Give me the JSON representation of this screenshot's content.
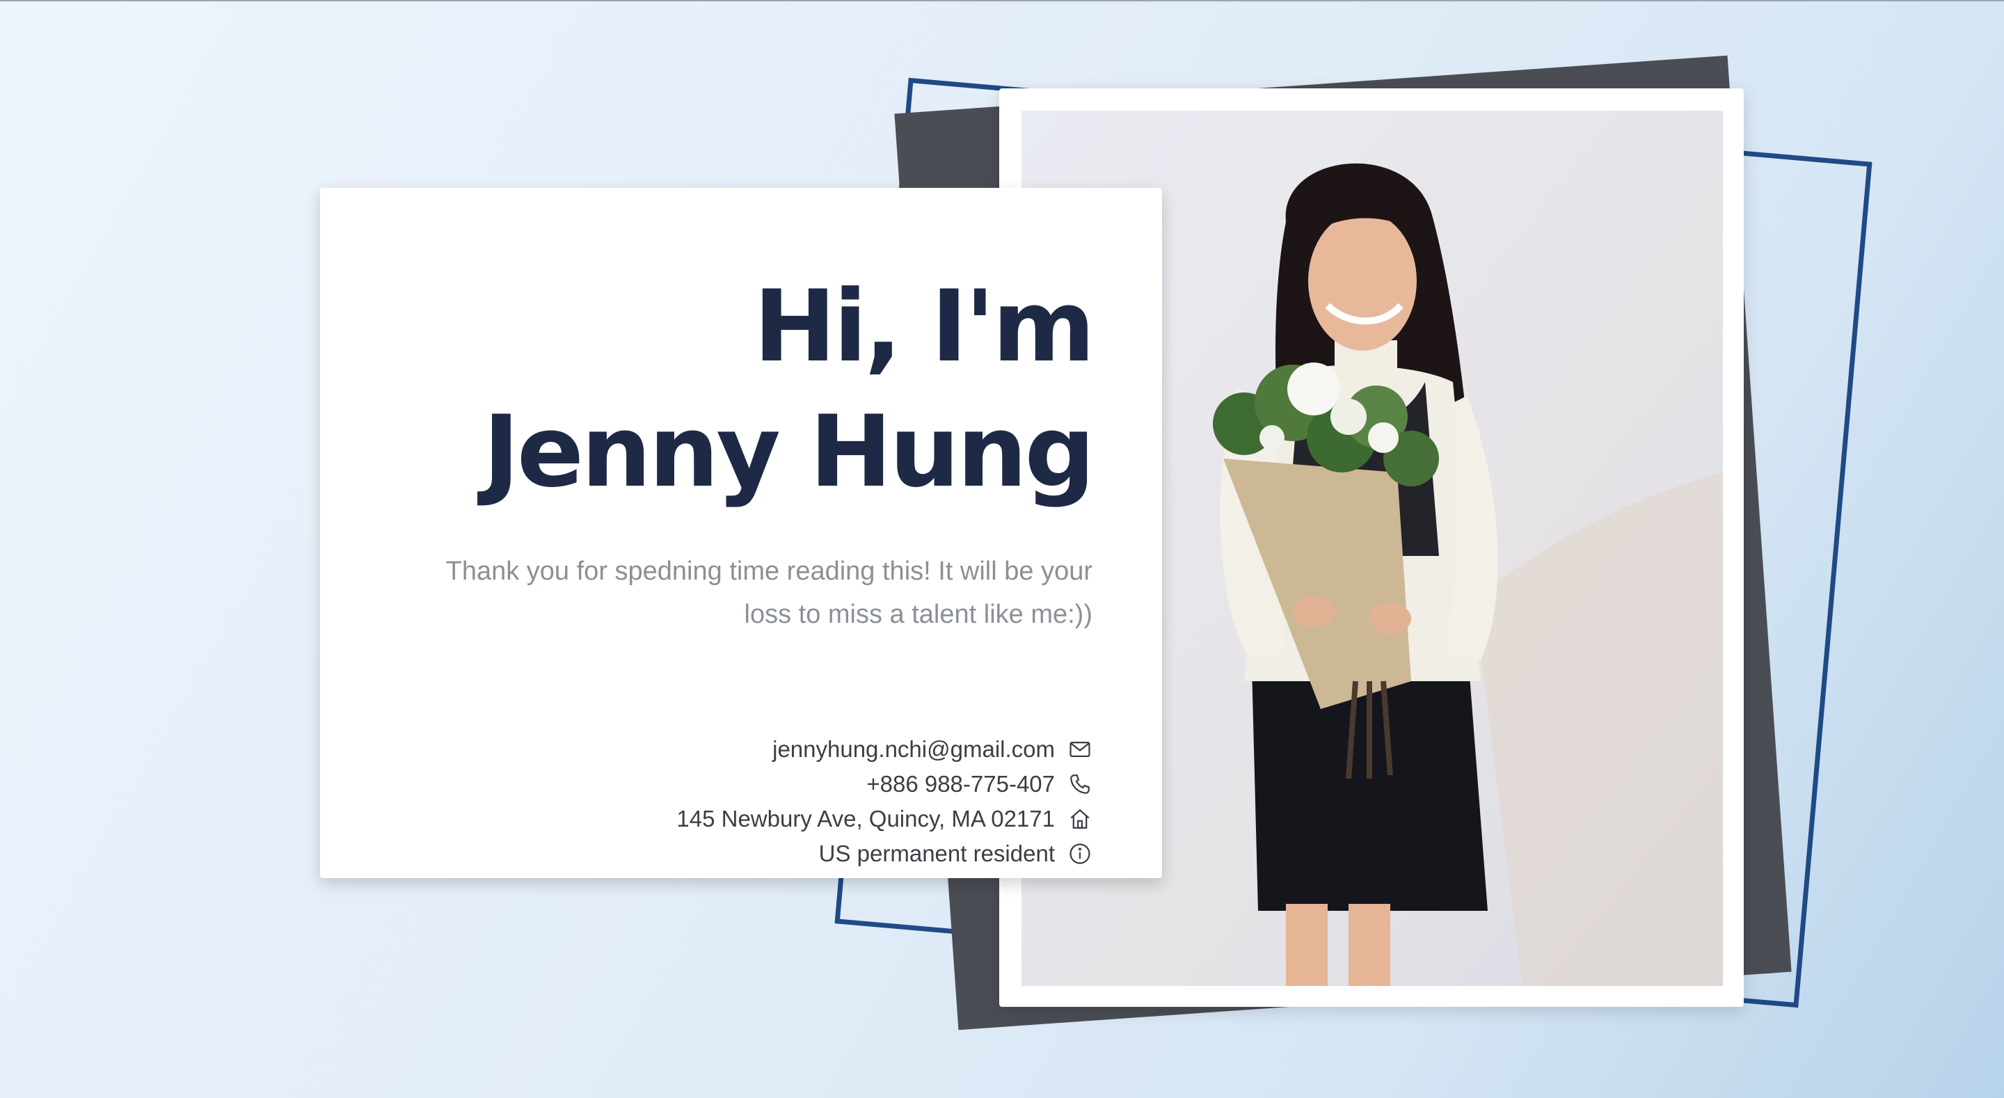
{
  "hero": {
    "greeting_line1": "Hi, I'm",
    "greeting_line2": "Jenny Hung",
    "subtitle": "Thank you for spedning time reading this! It will be your loss to miss a talent like me:))"
  },
  "contacts": [
    {
      "text": "jennyhung.nchi@gmail.com",
      "icon": "mail-icon"
    },
    {
      "text": "+886 988-775-407",
      "icon": "phone-icon"
    },
    {
      "text": "145 Newbury Ave, Quincy, MA 02171",
      "icon": "home-icon"
    },
    {
      "text": "US permanent resident",
      "icon": "info-icon"
    }
  ],
  "colors": {
    "heading": "#1e2a45",
    "subtitle": "#8b9096",
    "accent_frame": "#1f4a86",
    "dark_panel": "#4a4e54"
  }
}
